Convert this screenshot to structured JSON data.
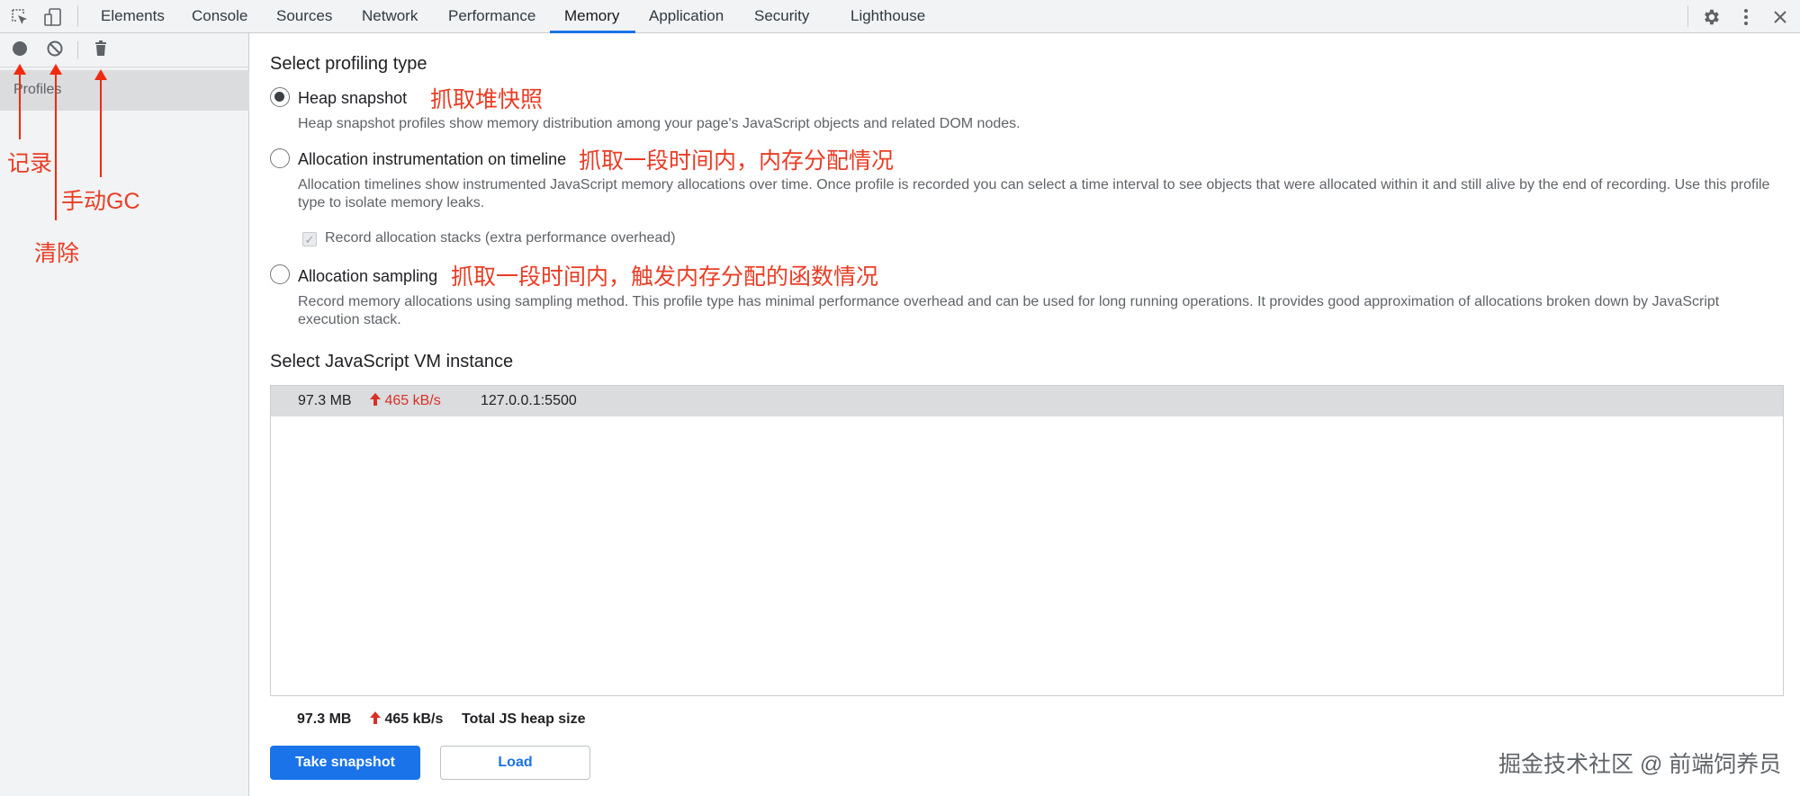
{
  "tabs": [
    "Elements",
    "Console",
    "Sources",
    "Network",
    "Performance",
    "Memory",
    "Application",
    "Security",
    "Lighthouse"
  ],
  "active_tab": "Memory",
  "sidebar": {
    "profiles_label": "Profiles"
  },
  "annotations": {
    "record": "记录",
    "gc": "手动GC",
    "clear": "清除"
  },
  "profiling": {
    "heading": "Select profiling type",
    "options": [
      {
        "label": "Heap snapshot",
        "annotation": "抓取堆快照",
        "description": "Heap snapshot profiles show memory distribution among your page's JavaScript objects and related DOM nodes.",
        "checked": true
      },
      {
        "label": "Allocation instrumentation on timeline",
        "annotation": "抓取一段时间内，内存分配情况",
        "description": "Allocation timelines show instrumented JavaScript memory allocations over time. Once profile is recorded you can select a time interval to see objects that were allocated within it and still alive by the end of recording. Use this profile type to isolate memory leaks.",
        "checked": false
      },
      {
        "label": "Allocation sampling",
        "annotation": "抓取一段时间内，触发内存分配的函数情况",
        "description": "Record memory allocations using sampling method. This profile type has minimal performance overhead and can be used for long running operations. It provides good approximation of allocations broken down by JavaScript execution stack.",
        "checked": false
      }
    ],
    "record_stacks_label": "Record allocation stacks (extra performance overhead)",
    "record_stacks_checked": true
  },
  "vm": {
    "heading": "Select JavaScript VM instance",
    "instance": {
      "size": "97.3 MB",
      "rate": "465 kB/s",
      "url": "127.0.0.1:5500"
    }
  },
  "footer": {
    "size": "97.3 MB",
    "rate": "465 kB/s",
    "label": "Total JS heap size",
    "take_snapshot": "Take snapshot",
    "load": "Load"
  },
  "watermark": "掘金技术社区 @ 前端饲养员",
  "colors": {
    "accent": "#1a73e8",
    "annotation": "#ea3c24",
    "rate_up": "#d93025"
  },
  "icons": [
    "inspect-icon",
    "device-toggle-icon",
    "settings-icon",
    "more-icon",
    "close-icon",
    "record-icon",
    "clear-icon",
    "trash-icon",
    "arrow-up-icon"
  ]
}
